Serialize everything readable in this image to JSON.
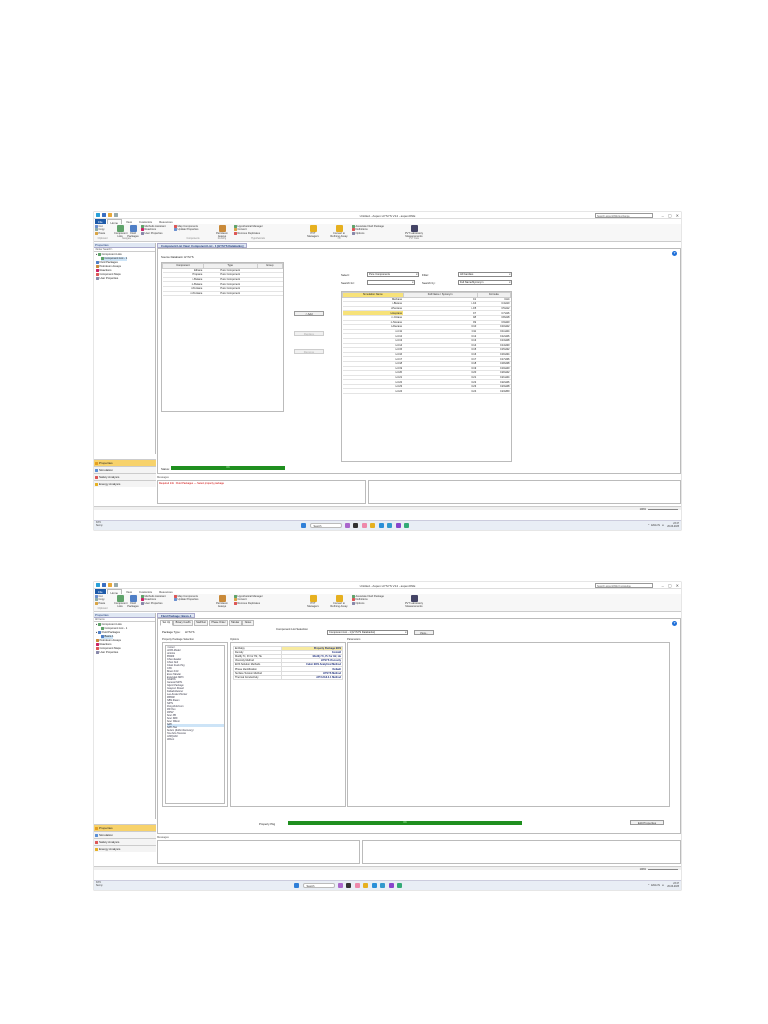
{
  "shot1": {
    "title": "Untitled - Aspen HYSYS V14 - aspenONE",
    "search_placeholder": "Search aspenONE Exchange",
    "window_controls": [
      "–",
      "▢",
      "✕"
    ],
    "tabs": [
      "File",
      "Home",
      "View",
      "Customize",
      "Resources"
    ],
    "ribbon": {
      "clipboard": {
        "items": [
          "Cut",
          "Copy",
          "Paste"
        ],
        "label": "Clipboard"
      },
      "component_lists": "Component Lists",
      "fluid_packages": "Fluid Packages",
      "navigate_label": "Navigate",
      "components": {
        "items": [
          "Methods Assistant",
          "Reactions",
          "User Properties"
        ],
        "label": "Components"
      },
      "map": {
        "items": [
          "Map Components",
          "Update Properties"
        ]
      },
      "petroleum_assays": "Petroleum Assays",
      "refining_label": "Refining",
      "hypo": {
        "items": [
          "Hypothetical Manager",
          "Convert",
          "Remove Duplicates"
        ],
        "label": "Hypotheticals"
      },
      "pvt_managers": "PVT Managers",
      "convert_refining": "Convert to Refining Assay",
      "oil_label": "Oil",
      "assoc": {
        "items": [
          "Associate Fluid Package",
          "Definitions",
          "Options"
        ]
      },
      "pvt_lab": "PVT Laboratory Measurements",
      "pvt_label": "PVT Data"
    },
    "left_pane": {
      "header": "Properties",
      "filter": "<Enter Search>",
      "tree": [
        "Component Lists",
        "Component List - 1",
        "Fluid Packages",
        "Petroleum Assays",
        "Reactions",
        "Component Maps",
        "User Properties"
      ]
    },
    "nav": [
      "Properties",
      "Simulation",
      "Safety Analysis",
      "Energy Analysis"
    ],
    "doc_tab": "Component List View: Component List - 1 [HYSYS Databanks]",
    "source_label": "Source Databank: HYSYS",
    "left_table": {
      "headers": [
        "Component",
        "Type",
        "Group"
      ],
      "rows": [
        [
          "Ethane",
          "Pure Component",
          ""
        ],
        [
          "Propane",
          "Pure Component",
          ""
        ],
        [
          "i-Butane",
          "Pure Component",
          ""
        ],
        [
          "n-Butane",
          "Pure Component",
          ""
        ],
        [
          "i-Pentane",
          "Pure Component",
          ""
        ],
        [
          "n-Pentane",
          "Pure Component",
          ""
        ]
      ]
    },
    "buttons": {
      "add": "< Add",
      "replace": "Replace",
      "remove": "Remove"
    },
    "select_label": "Select:",
    "select_value": "Pure Components",
    "filter_label": "Filter:",
    "filter_value": "All Families",
    "search_for_label": "Search for:",
    "search_by_label": "Search by:",
    "search_by_value": "Full Name/Synonym",
    "right_table": {
      "headers": [
        "Simulation Name",
        "Full Name / Synonym",
        "Formula"
      ],
      "rows": [
        [
          "Methane",
          "C1",
          "CH4"
        ],
        [
          "i-Butene",
          "i-C4",
          "C4H10"
        ],
        [
          "i-Pentene",
          "i-C5",
          "C5H12"
        ],
        [
          "n-Heptane",
          "C7",
          "C7H16"
        ],
        [
          "n-Octane",
          "C8",
          "C8H18"
        ],
        [
          "n-Nonane",
          "C9",
          "C9H20"
        ],
        [
          "n-Decane",
          "C10",
          "C10H22"
        ],
        [
          "n-C11",
          "C11",
          "C11H24"
        ],
        [
          "n-C12",
          "C12",
          "C12H26"
        ],
        [
          "n-C13",
          "C13",
          "C13H28"
        ],
        [
          "n-C14",
          "C14",
          "C14H30"
        ],
        [
          "n-C15",
          "C15",
          "C15H32"
        ],
        [
          "n-C16",
          "C16",
          "C16H34"
        ],
        [
          "n-C17",
          "C17",
          "C17H36"
        ],
        [
          "n-C18",
          "C18",
          "C18H38"
        ],
        [
          "n-C19",
          "C19",
          "C19H40"
        ],
        [
          "n-C20",
          "C20",
          "C20H42"
        ],
        [
          "n-C21",
          "C21",
          "C21H44"
        ],
        [
          "n-C22",
          "C22",
          "C22H46"
        ],
        [
          "n-C23",
          "C23",
          "C23H48"
        ],
        [
          "n-C24",
          "C24",
          "C24H50"
        ]
      ]
    },
    "status_label": "Status:",
    "status_value": "OK",
    "messages_label": "Messages",
    "message_text": "Required Info : Fluid Packages — Select property package",
    "zoom": "100%",
    "taskbar": {
      "weather_temp": "34°C",
      "weather_desc": "Sunny",
      "search": "Search",
      "lang": "ENG IN",
      "time": "23:47",
      "date": "26-03-2025"
    }
  },
  "shot2": {
    "title": "Untitled - Aspen HYSYS V14 - aspenONE",
    "search_placeholder": "Search aspenONE Knowledge",
    "window_controls": [
      "–",
      "▢",
      "✕"
    ],
    "tabs": [
      "File",
      "Home",
      "View",
      "Customize",
      "Resources"
    ],
    "left_pane": {
      "header": "Properties",
      "filter": "All Items",
      "tree": [
        "Component Lists",
        "Component List - 1",
        "Fluid Packages",
        "Basis-1",
        "Petroleum Assays",
        "Reactions",
        "Component Maps",
        "User Properties"
      ]
    },
    "nav": [
      "Properties",
      "Simulation",
      "Safety Analysis",
      "Energy Analysis"
    ],
    "doc_tab": "Fluid Package: Basis-1",
    "sub_tabs": [
      "Set Up",
      "Binary Coeffs",
      "StabTest",
      "Phase Order",
      "Tabular",
      "Notes"
    ],
    "package_type_label": "Package Type:",
    "package_type_value": "HYSYS",
    "comp_list_label": "Component List Selection",
    "comp_list_value": "Component List - 1 [HYSYS Databanks]",
    "view_button": "View...",
    "pp_selection_title": "Property Package Selection",
    "pp_list": [
      "<none>",
      "ACPA Model",
      "Antoine",
      "BWRS",
      "Chao-Seader",
      "Chien Null",
      "Clean Fuels Pkg",
      "CPA",
      "Braun K10",
      "Esso Tabular",
      "Extended NRTL",
      "GCEOS",
      "General NRTL",
      "Glycol Package",
      "Grayson Streed",
      "Kabadi-Danner",
      "Lee-Kesler-Plocker",
      "MBWR",
      "NBS Steam",
      "NRTL",
      "Peng-Robinson",
      "PR-Twu",
      "PRSV",
      "Sour PR",
      "Sour SRK",
      "Sour Wilson",
      "SRK",
      "SRK-Twu",
      "Sulsim (Sulfur Recovery)",
      "Twu-Sim-Tassone",
      "UNIQUAC",
      "Wilson"
    ],
    "pp_selected_index": 26,
    "options_title": "Options",
    "options": [
      [
        "Enthalpy",
        "Property Package EOS"
      ],
      [
        "Density",
        "Costald"
      ],
      [
        "Modify Tc, Pc for H2, He",
        "Modify Tc, Pc for H2, He"
      ],
      [
        "Viscosity Method",
        "HYSYS Viscosity"
      ],
      [
        "EOS Solution Methods",
        "Cubic EOS Analytical Method"
      ],
      [
        "Phase Identification",
        "Default"
      ],
      [
        "Surface Tension Method",
        "HYSYS Method"
      ],
      [
        "Thermal Conductivity",
        "API 12A3.2-1 Method"
      ]
    ],
    "parameters_title": "Parameters",
    "property_pkg_label": "Property Pkg",
    "property_pkg_status": "OK",
    "edit_properties_button": "Edit Properties",
    "messages_label": "Messages",
    "zoom": "100%",
    "taskbar": {
      "weather_temp": "34°C",
      "weather_desc": "Sunny",
      "search": "Search",
      "lang": "ENG IN",
      "time": "23:47",
      "date": "26-03-2025"
    }
  },
  "colors": {
    "file_tab": "#1e5aa8",
    "active_nav": "#f7d26b",
    "ok_bar": "#1f8f1f",
    "selection": "#cde4f7",
    "header_highlight": "#f7e27a"
  }
}
